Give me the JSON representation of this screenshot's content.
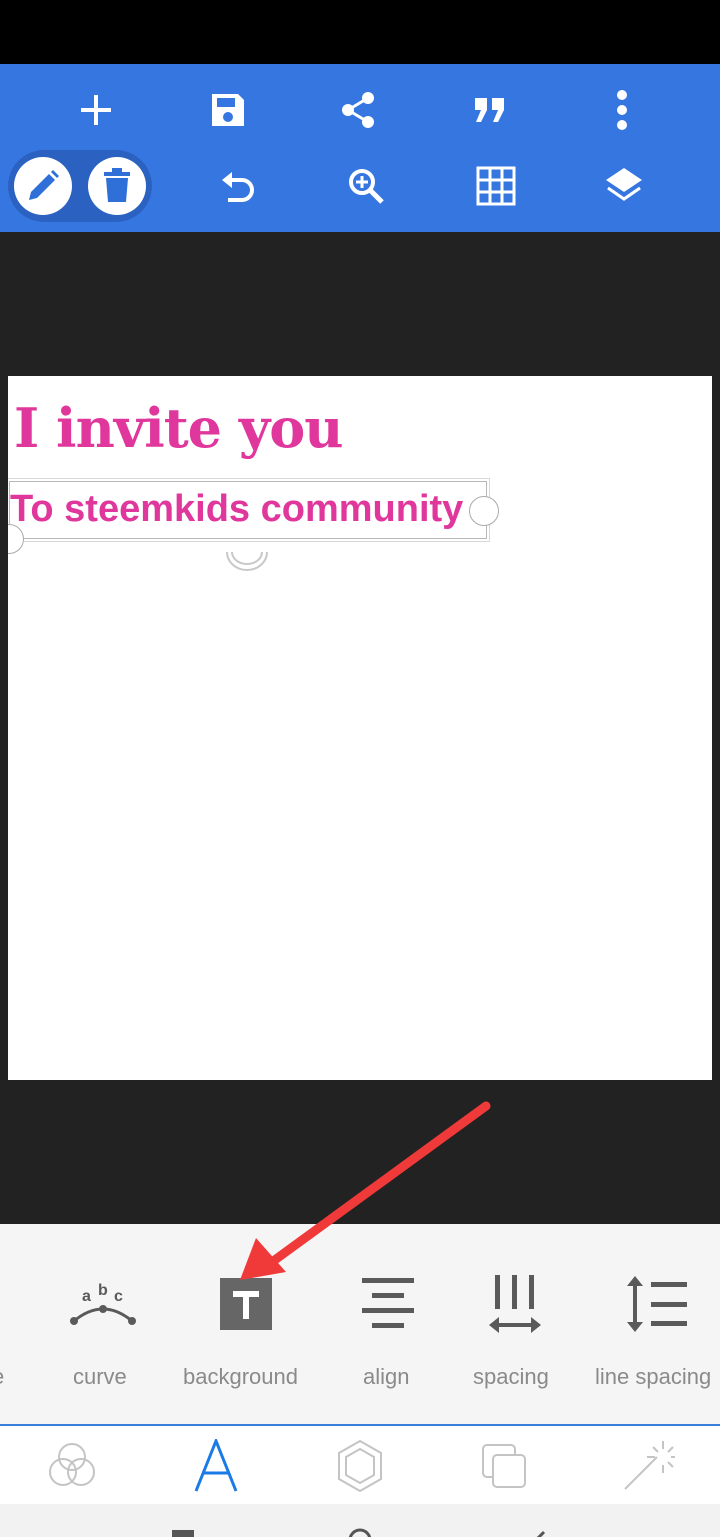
{
  "colors": {
    "toolbar": "#3676e0",
    "accent_text": "#e0379d",
    "arrow": "#f03a3a",
    "active_tab": "#1a7ae6"
  },
  "toolbar": {
    "icons": [
      "plus-icon",
      "save-icon",
      "share-icon",
      "quote-icon",
      "more-vert-icon",
      "pencil-icon",
      "trash-icon",
      "undo-icon",
      "zoom-in-icon",
      "grid-icon",
      "layers-icon"
    ]
  },
  "canvas": {
    "title": "I invite you",
    "subtitle": "To steemkids community"
  },
  "text_tools": {
    "partial_left_label": "e",
    "items": [
      {
        "label": "curve",
        "icon": "curve-text-icon"
      },
      {
        "label": "background",
        "icon": "text-background-icon"
      },
      {
        "label": "align",
        "icon": "align-center-icon"
      },
      {
        "label": "spacing",
        "icon": "letter-spacing-icon"
      },
      {
        "label": "line spacing",
        "icon": "line-spacing-icon"
      }
    ]
  },
  "bottom_tabs": [
    {
      "icon": "blend-icon",
      "active": false
    },
    {
      "icon": "text-icon",
      "active": true,
      "glyph": "A"
    },
    {
      "icon": "shape-icon",
      "active": false
    },
    {
      "icon": "duplicate-icon",
      "active": false
    },
    {
      "icon": "magic-wand-icon",
      "active": false
    }
  ]
}
